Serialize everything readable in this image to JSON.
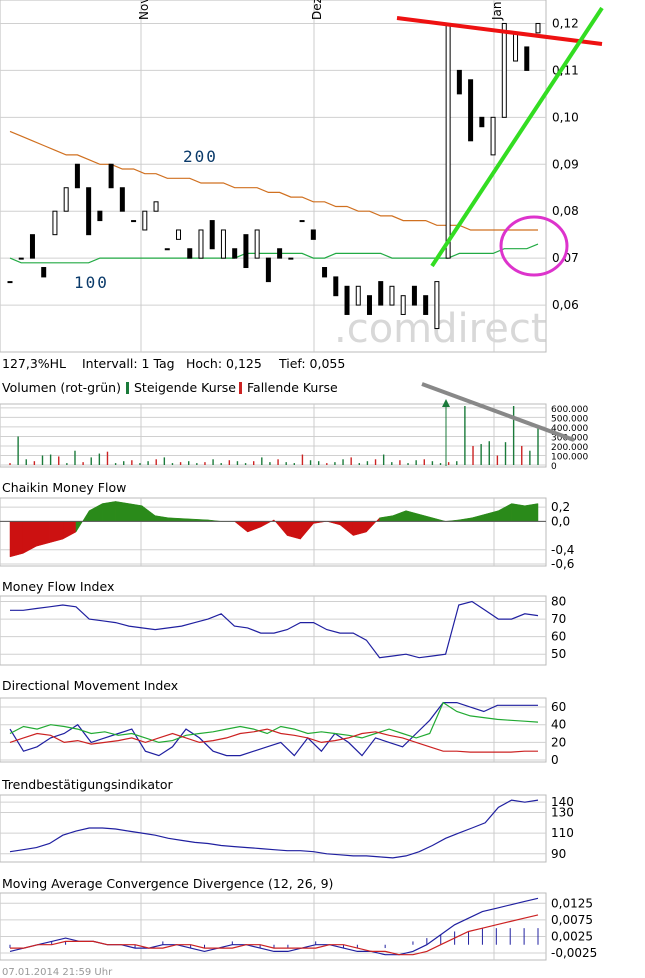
{
  "watermark": ".comdirect",
  "footer": "07.01.2014 21:59 Uhr",
  "x_months": [
    "Nov",
    "Dez",
    "Jan"
  ],
  "stats": {
    "range": "127,3%HL",
    "interval": "Intervall: 1 Tag",
    "high": "Hoch:  0,125",
    "low": "Tief:  0,055"
  },
  "ma_labels": {
    "ma200": "200",
    "ma100": "100"
  },
  "volume_legend": {
    "title": "Volumen (rot-grün)",
    "rising": "Steigende Kurse",
    "falling": "Fallende Kurse",
    "rising_color": "#1a7a3a",
    "falling_color": "#cc2222"
  },
  "colors": {
    "ma200": "#d07020",
    "ma100": "#22aa44",
    "red_line": "#ee1111",
    "green_line": "#33dd22",
    "circle": "#dd33cc",
    "grey_line": "#888888",
    "indicator_line": "#2020a0",
    "cmf_pos": "#2a8a1a",
    "cmf_neg": "#cc1111"
  },
  "chart_data": [
    {
      "type": "candlestick",
      "title": "",
      "ylim": [
        0.05,
        0.125
      ],
      "y_ticks": [
        "0,06",
        "0,07",
        "0,08",
        "0,09",
        "0,10",
        "0,11",
        "0,12"
      ],
      "y_values": [
        0.06,
        0.07,
        0.08,
        0.09,
        0.1,
        0.11,
        0.12
      ],
      "candles": [
        {
          "o": 0.065,
          "c": 0.065
        },
        {
          "o": 0.07,
          "c": 0.07
        },
        {
          "o": 0.075,
          "c": 0.07
        },
        {
          "o": 0.068,
          "c": 0.066
        },
        {
          "o": 0.075,
          "c": 0.08
        },
        {
          "o": 0.08,
          "c": 0.085
        },
        {
          "o": 0.09,
          "c": 0.085
        },
        {
          "o": 0.085,
          "c": 0.075
        },
        {
          "o": 0.08,
          "c": 0.078
        },
        {
          "o": 0.09,
          "c": 0.085
        },
        {
          "o": 0.085,
          "c": 0.08
        },
        {
          "o": 0.078,
          "c": 0.078
        },
        {
          "o": 0.076,
          "c": 0.08
        },
        {
          "o": 0.08,
          "c": 0.082
        },
        {
          "o": 0.072,
          "c": 0.072
        },
        {
          "o": 0.074,
          "c": 0.076
        },
        {
          "o": 0.072,
          "c": 0.07
        },
        {
          "o": 0.07,
          "c": 0.076
        },
        {
          "o": 0.078,
          "c": 0.072
        },
        {
          "o": 0.07,
          "c": 0.076
        },
        {
          "o": 0.072,
          "c": 0.07
        },
        {
          "o": 0.075,
          "c": 0.068
        },
        {
          "o": 0.07,
          "c": 0.076
        },
        {
          "o": 0.07,
          "c": 0.065
        },
        {
          "o": 0.072,
          "c": 0.07
        },
        {
          "o": 0.07,
          "c": 0.07
        },
        {
          "o": 0.078,
          "c": 0.078
        },
        {
          "o": 0.076,
          "c": 0.074
        },
        {
          "o": 0.068,
          "c": 0.066
        },
        {
          "o": 0.066,
          "c": 0.062
        },
        {
          "o": 0.064,
          "c": 0.058
        },
        {
          "o": 0.06,
          "c": 0.064
        },
        {
          "o": 0.062,
          "c": 0.058
        },
        {
          "o": 0.065,
          "c": 0.06
        },
        {
          "o": 0.06,
          "c": 0.064
        },
        {
          "o": 0.058,
          "c": 0.062
        },
        {
          "o": 0.064,
          "c": 0.06
        },
        {
          "o": 0.062,
          "c": 0.058
        },
        {
          "o": 0.055,
          "c": 0.065
        },
        {
          "o": 0.07,
          "c": 0.12
        },
        {
          "o": 0.11,
          "c": 0.105
        },
        {
          "o": 0.108,
          "c": 0.095
        },
        {
          "o": 0.1,
          "c": 0.098
        },
        {
          "o": 0.092,
          "c": 0.1
        },
        {
          "o": 0.1,
          "c": 0.12
        },
        {
          "o": 0.112,
          "c": 0.118
        },
        {
          "o": 0.115,
          "c": 0.11
        },
        {
          "o": 0.118,
          "c": 0.12
        }
      ],
      "series": [
        {
          "name": "200",
          "values": [
            0.097,
            0.096,
            0.095,
            0.094,
            0.093,
            0.092,
            0.092,
            0.091,
            0.09,
            0.09,
            0.089,
            0.089,
            0.088,
            0.088,
            0.087,
            0.087,
            0.087,
            0.086,
            0.086,
            0.086,
            0.085,
            0.085,
            0.085,
            0.084,
            0.084,
            0.083,
            0.083,
            0.082,
            0.082,
            0.081,
            0.081,
            0.08,
            0.08,
            0.079,
            0.079,
            0.078,
            0.078,
            0.078,
            0.077,
            0.077,
            0.077,
            0.076,
            0.076,
            0.076,
            0.076,
            0.076,
            0.076,
            0.076
          ]
        },
        {
          "name": "100",
          "values": [
            0.07,
            0.069,
            0.069,
            0.069,
            0.069,
            0.069,
            0.069,
            0.069,
            0.07,
            0.07,
            0.07,
            0.07,
            0.07,
            0.07,
            0.07,
            0.07,
            0.07,
            0.07,
            0.07,
            0.07,
            0.07,
            0.071,
            0.071,
            0.071,
            0.071,
            0.071,
            0.071,
            0.07,
            0.07,
            0.071,
            0.071,
            0.071,
            0.071,
            0.071,
            0.07,
            0.07,
            0.07,
            0.07,
            0.07,
            0.07,
            0.071,
            0.071,
            0.071,
            0.071,
            0.072,
            0.072,
            0.072,
            0.073
          ]
        }
      ]
    },
    {
      "type": "bar",
      "title": "Volumen (rot-grün)",
      "ylim": [
        0,
        620000
      ],
      "y_ticks": [
        "600.000",
        "500.000",
        "400.000",
        "300.000",
        "200.000",
        "100.000",
        "0"
      ],
      "y_values": [
        600000,
        500000,
        400000,
        300000,
        200000,
        100000,
        0
      ],
      "values": [
        20000,
        300000,
        60000,
        40000,
        100000,
        110000,
        90000,
        20000,
        150000,
        30000,
        80000,
        120000,
        140000,
        20000,
        40000,
        50000,
        20000,
        40000,
        60000,
        80000,
        20000,
        30000,
        40000,
        20000,
        30000,
        60000,
        20000,
        50000,
        40000,
        20000,
        40000,
        80000,
        30000,
        60000,
        30000,
        20000,
        110000,
        50000,
        40000,
        20000,
        30000,
        60000,
        80000,
        20000,
        40000,
        60000,
        110000,
        30000,
        50000,
        20000,
        50000,
        60000,
        40000,
        20000,
        30000,
        40000,
        620000,
        200000,
        220000,
        250000,
        100000,
        240000,
        620000,
        200000,
        150000,
        400000
      ]
    },
    {
      "type": "area",
      "title": "Chaikin Money Flow",
      "ylim": [
        -0.6,
        0.3
      ],
      "y_ticks": [
        "0,2",
        "0,0",
        "-0,4",
        "-0,6"
      ],
      "y_values": [
        0.2,
        0.0,
        -0.4,
        -0.6
      ],
      "values": [
        -0.5,
        -0.45,
        -0.35,
        -0.3,
        -0.25,
        -0.15,
        0.15,
        0.25,
        0.28,
        0.25,
        0.22,
        0.08,
        0.05,
        0.04,
        0.03,
        0.02,
        0.0,
        0.0,
        -0.15,
        -0.08,
        0.02,
        -0.2,
        -0.25,
        -0.03,
        0.0,
        -0.05,
        -0.2,
        -0.15,
        0.05,
        0.08,
        0.15,
        0.1,
        0.05,
        0.0,
        0.02,
        0.05,
        0.1,
        0.15,
        0.25,
        0.22,
        0.25
      ]
    },
    {
      "type": "line",
      "title": "Money Flow Index",
      "ylim": [
        45,
        82
      ],
      "y_ticks": [
        "80",
        "70",
        "60",
        "50"
      ],
      "y_values": [
        80,
        70,
        60,
        50
      ],
      "values": [
        75,
        75,
        76,
        77,
        78,
        77,
        70,
        69,
        68,
        66,
        65,
        64,
        65,
        66,
        68,
        70,
        73,
        66,
        65,
        62,
        62,
        64,
        68,
        68,
        64,
        62,
        62,
        58,
        48,
        49,
        50,
        48,
        49,
        50,
        78,
        80,
        75,
        70,
        70,
        73,
        72
      ]
    },
    {
      "type": "line",
      "title": "Directional Movement Index",
      "ylim": [
        0,
        68
      ],
      "y_ticks": [
        "60",
        "40",
        "20",
        "0"
      ],
      "y_values": [
        60,
        40,
        20,
        0
      ],
      "series": [
        {
          "values": [
            35,
            10,
            15,
            25,
            30,
            40,
            20,
            25,
            30,
            35,
            10,
            5,
            15,
            35,
            25,
            10,
            5,
            5,
            10,
            15,
            20,
            5,
            25,
            10,
            30,
            20,
            5,
            25,
            20,
            15,
            30,
            45,
            65,
            65,
            60,
            55,
            62,
            62,
            62,
            62
          ]
        },
        {
          "values": [
            30,
            38,
            35,
            40,
            38,
            35,
            30,
            32,
            28,
            30,
            25,
            20,
            22,
            28,
            30,
            32,
            35,
            38,
            35,
            30,
            38,
            35,
            30,
            32,
            30,
            28,
            25,
            30,
            35,
            30,
            25,
            30,
            65,
            55,
            50,
            48,
            46,
            45,
            44,
            43
          ]
        },
        {
          "values": [
            20,
            25,
            30,
            28,
            20,
            22,
            18,
            20,
            22,
            25,
            20,
            25,
            30,
            25,
            20,
            22,
            25,
            30,
            32,
            35,
            30,
            28,
            25,
            20,
            22,
            25,
            30,
            32,
            28,
            25,
            20,
            15,
            10,
            10,
            9,
            9,
            9,
            9,
            10,
            10
          ]
        }
      ]
    },
    {
      "type": "line",
      "title": "Trendbestätigungsindikator",
      "ylim": [
        84,
        145
      ],
      "y_ticks": [
        "140",
        "130",
        "110",
        "90"
      ],
      "y_values": [
        140,
        130,
        110,
        90
      ],
      "values": [
        92,
        94,
        96,
        100,
        108,
        112,
        115,
        115,
        114,
        112,
        110,
        108,
        105,
        103,
        101,
        100,
        98,
        97,
        96,
        95,
        94,
        93,
        93,
        92,
        90,
        89,
        88,
        88,
        87,
        86,
        88,
        92,
        98,
        105,
        110,
        115,
        120,
        135,
        142,
        140,
        142
      ]
    },
    {
      "type": "line",
      "title": "Moving Average Convergence Divergence (12, 26, 9)",
      "ylim": [
        -0.004,
        0.015
      ],
      "y_ticks": [
        "0,0125",
        "0,0075",
        "0,0025",
        "-0,0025"
      ],
      "y_values": [
        0.0125,
        0.0075,
        0.0025,
        -0.0025
      ],
      "series": [
        {
          "values": [
            -0.002,
            -0.001,
            0.0,
            0.001,
            0.002,
            0.001,
            0.001,
            0.0,
            0.0,
            -0.001,
            -0.001,
            0.0,
            0.0,
            -0.001,
            -0.002,
            -0.001,
            0.0,
            0.0,
            -0.001,
            -0.002,
            -0.002,
            -0.001,
            0.0,
            0.0,
            -0.001,
            -0.002,
            -0.002,
            -0.003,
            -0.003,
            -0.002,
            0.0,
            0.003,
            0.006,
            0.008,
            0.01,
            0.011,
            0.012,
            0.013,
            0.014
          ]
        },
        {
          "values": [
            -0.001,
            -0.001,
            0.0,
            0.0,
            0.001,
            0.001,
            0.001,
            0.0,
            0.0,
            0.0,
            -0.001,
            -0.001,
            0.0,
            0.0,
            -0.001,
            -0.001,
            -0.001,
            0.0,
            0.0,
            -0.001,
            -0.001,
            -0.001,
            -0.001,
            0.0,
            0.0,
            -0.001,
            -0.002,
            -0.002,
            -0.003,
            -0.003,
            -0.002,
            0.0,
            0.002,
            0.004,
            0.005,
            0.006,
            0.007,
            0.008,
            0.009
          ]
        },
        {
          "values": [
            -0.001,
            0.0,
            0.0,
            0.001,
            0.001,
            0.0,
            0.0,
            0.0,
            0.0,
            -0.001,
            0.0,
            0.001,
            0.0,
            -0.001,
            -0.001,
            0.0,
            0.001,
            0.0,
            -0.001,
            -0.001,
            -0.001,
            0.0,
            0.001,
            0.0,
            -0.001,
            -0.001,
            0.0,
            -0.001,
            0.0,
            0.001,
            0.002,
            0.003,
            0.004,
            0.004,
            0.005,
            0.005,
            0.005,
            0.005,
            0.005
          ]
        }
      ]
    }
  ]
}
